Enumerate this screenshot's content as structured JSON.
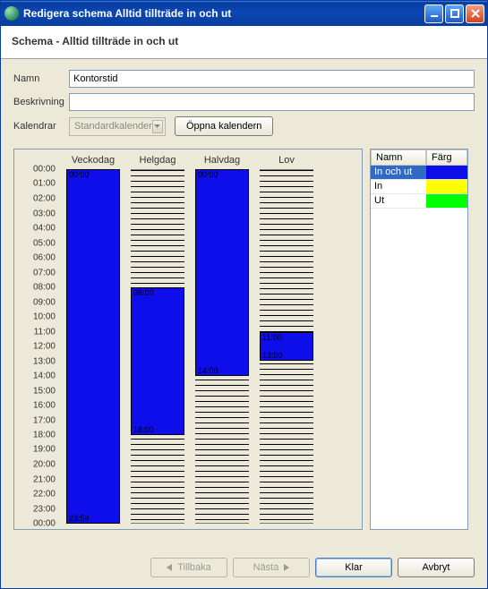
{
  "window": {
    "title": "Redigera schema Alltid tillträde in och ut"
  },
  "subheader": "Schema - Alltid tillträde in och ut",
  "form": {
    "name_label": "Namn",
    "name_value": "Kontorstid",
    "desc_label": "Beskrivning",
    "desc_value": "",
    "cal_label": "Kalendrar",
    "cal_combo": "Standardkalender",
    "open_cal_btn": "Öppna kalendern"
  },
  "chart_data": {
    "type": "bar",
    "columns": [
      "Veckodag",
      "Helgdag",
      "Halvdag",
      "Lov"
    ],
    "y_ticks": [
      "00:00",
      "01:00",
      "02:00",
      "03:00",
      "04:00",
      "05:00",
      "06:00",
      "07:00",
      "08:00",
      "09:00",
      "10:00",
      "11:00",
      "12:00",
      "13:00",
      "14:00",
      "15:00",
      "16:00",
      "17:00",
      "18:00",
      "19:00",
      "20:00",
      "21:00",
      "22:00",
      "23:00",
      "00:00"
    ],
    "y_range_minutes": [
      0,
      1440
    ],
    "bars": [
      {
        "col": 0,
        "start": "00:00",
        "end": "23:59",
        "start_min": 0,
        "end_min": 1439,
        "color": "#0e0eea"
      },
      {
        "col": 1,
        "start": "08:00",
        "end": "18:00",
        "start_min": 480,
        "end_min": 1080,
        "color": "#0e0eea"
      },
      {
        "col": 2,
        "start": "00:00",
        "end": "14:00",
        "start_min": 0,
        "end_min": 840,
        "color": "#0e0eea"
      },
      {
        "col": 3,
        "start": "11:00",
        "end": "13:00",
        "start_min": 660,
        "end_min": 780,
        "color": "#0e0eea"
      }
    ]
  },
  "legend": {
    "head_name": "Namn",
    "head_color": "Färg",
    "rows": [
      {
        "name": "In och ut",
        "color": "#0e0eea",
        "selected": true
      },
      {
        "name": "In",
        "color": "#ffff00",
        "selected": false
      },
      {
        "name": "Ut",
        "color": "#00ff00",
        "selected": false
      }
    ]
  },
  "footer": {
    "back": "Tillbaka",
    "next": "Nästa",
    "done": "Klar",
    "cancel": "Avbryt"
  }
}
